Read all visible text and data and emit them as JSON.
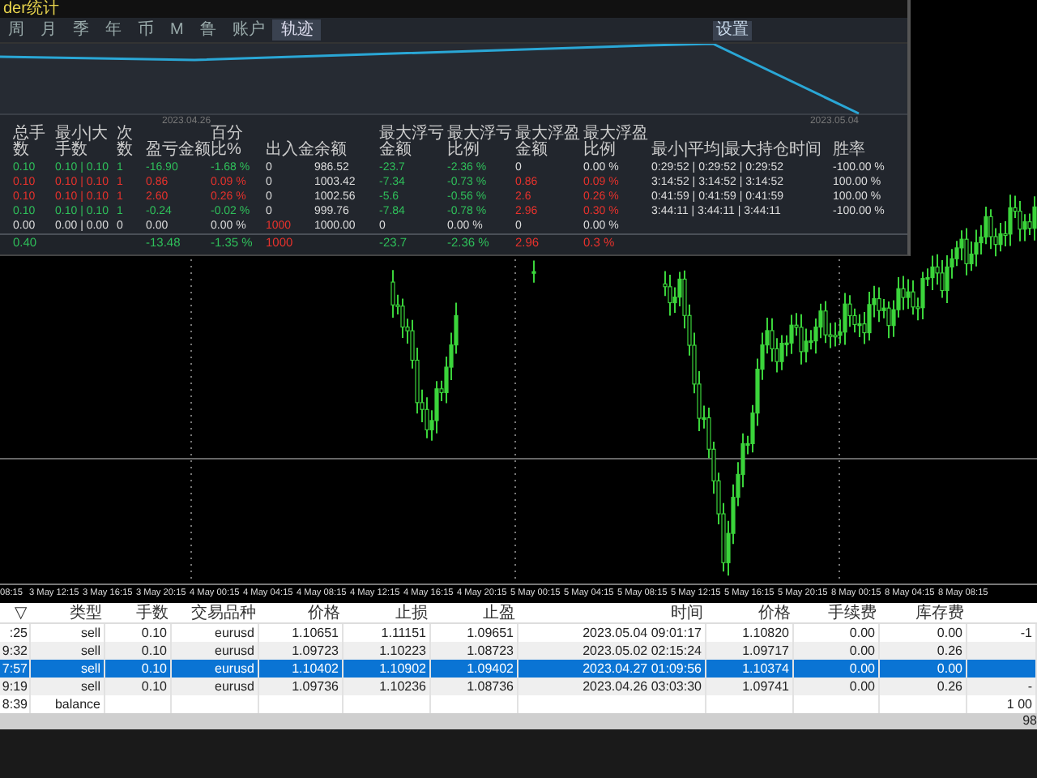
{
  "stats_panel": {
    "title": "der统计",
    "tabs": [
      {
        "label": "周",
        "selected": false
      },
      {
        "label": "月",
        "selected": false
      },
      {
        "label": "季",
        "selected": false
      },
      {
        "label": "年",
        "selected": false
      },
      {
        "label": "币",
        "selected": false
      },
      {
        "label": "M",
        "selected": false
      },
      {
        "label": "鲁",
        "selected": false
      },
      {
        "label": "账户",
        "selected": false
      },
      {
        "label": "轨迹",
        "selected": true
      }
    ],
    "corner_button": "设置",
    "equity_chart": {
      "start_date": "2023.04.26",
      "end_date": "2023.05.04"
    },
    "columns": [
      "总手数",
      "最小|大手数",
      "次数",
      "盈亏金额",
      "百分比%",
      "出入金",
      "余额",
      "最大浮亏金额",
      "最大浮亏比例",
      "最大浮盈金额",
      "最大浮盈比例",
      "最小|平均|最大持仓时间",
      "胜率"
    ],
    "rows": [
      {
        "total": false,
        "cells": [
          {
            "text": "0.10",
            "color": "#2fbf5a"
          },
          {
            "text": "0.10 | 0.10",
            "color": "#2fbf5a"
          },
          {
            "text": "1",
            "color": "#2fbf5a"
          },
          {
            "text": "-16.90",
            "color": "#2fbf5a"
          },
          {
            "text": "-1.68 %",
            "color": "#2fbf5a"
          },
          "0",
          "986.52",
          {
            "text": "-23.7",
            "color": "#2fbf5a"
          },
          {
            "text": "-2.36 %",
            "color": "#2fbf5a"
          },
          "0",
          "0.00 %",
          "0:29:52 | 0:29:52 | 0:29:52",
          "-100.00 %"
        ]
      },
      {
        "total": false,
        "cells": [
          {
            "text": "0.10",
            "color": "#e8322c"
          },
          {
            "text": "0.10 | 0.10",
            "color": "#e8322c"
          },
          {
            "text": "1",
            "color": "#e8322c"
          },
          {
            "text": "0.86",
            "color": "#e8322c"
          },
          {
            "text": "0.09 %",
            "color": "#e8322c"
          },
          "0",
          "1003.42",
          {
            "text": "-7.34",
            "color": "#2fbf5a"
          },
          {
            "text": "-0.73 %",
            "color": "#2fbf5a"
          },
          {
            "text": "0.86",
            "color": "#e8322c"
          },
          {
            "text": "0.09 %",
            "color": "#e8322c"
          },
          "3:14:52 | 3:14:52 | 3:14:52",
          "100.00 %"
        ]
      },
      {
        "total": false,
        "cells": [
          {
            "text": "0.10",
            "color": "#e8322c"
          },
          {
            "text": "0.10 | 0.10",
            "color": "#e8322c"
          },
          {
            "text": "1",
            "color": "#e8322c"
          },
          {
            "text": "2.60",
            "color": "#e8322c"
          },
          {
            "text": "0.26 %",
            "color": "#e8322c"
          },
          "0",
          "1002.56",
          {
            "text": "-5.6",
            "color": "#2fbf5a"
          },
          {
            "text": "-0.56 %",
            "color": "#2fbf5a"
          },
          {
            "text": "2.6",
            "color": "#e8322c"
          },
          {
            "text": "0.26 %",
            "color": "#e8322c"
          },
          "0:41:59 | 0:41:59 | 0:41:59",
          "100.00 %"
        ]
      },
      {
        "total": false,
        "cells": [
          {
            "text": "0.10",
            "color": "#2fbf5a"
          },
          {
            "text": "0.10 | 0.10",
            "color": "#2fbf5a"
          },
          {
            "text": "1",
            "color": "#2fbf5a"
          },
          {
            "text": "-0.24",
            "color": "#2fbf5a"
          },
          {
            "text": "-0.02 %",
            "color": "#2fbf5a"
          },
          "0",
          "999.76",
          {
            "text": "-7.84",
            "color": "#2fbf5a"
          },
          {
            "text": "-0.78 %",
            "color": "#2fbf5a"
          },
          {
            "text": "2.96",
            "color": "#e8322c"
          },
          {
            "text": "0.30 %",
            "color": "#e8322c"
          },
          "3:44:11 | 3:44:11 | 3:44:11",
          "-100.00 %"
        ]
      },
      {
        "total": false,
        "cells": [
          "0.00",
          "0.00 | 0.00",
          "0",
          "0.00",
          "0.00 %",
          {
            "text": "1000",
            "color": "#e8322c"
          },
          "1000.00",
          "0",
          "0.00 %",
          "0",
          "0.00 %"
        ]
      },
      {
        "total": true,
        "cells": [
          {
            "text": "0.40",
            "color": "#2fbf5a"
          },
          null,
          null,
          {
            "text": "-13.48",
            "color": "#2fbf5a"
          },
          {
            "text": "-1.35 %",
            "color": "#2fbf5a"
          },
          {
            "text": "1000",
            "color": "#e8322c"
          },
          null,
          {
            "text": "-23.7",
            "color": "#2fbf5a"
          },
          {
            "text": "-2.36 %",
            "color": "#2fbf5a"
          },
          {
            "text": "2.96",
            "color": "#e8322c"
          },
          {
            "text": "0.3 %",
            "color": "#e8322c"
          }
        ]
      }
    ]
  },
  "price_chart": {
    "time_labels": [
      "08:15",
      "3 May 12:15",
      "3 May 16:15",
      "3 May 20:15",
      "4 May 00:15",
      "4 May 04:15",
      "4 May 08:15",
      "4 May 12:15",
      "4 May 16:15",
      "4 May 20:15",
      "5 May 00:15",
      "5 May 04:15",
      "5 May 08:15",
      "5 May 12:15",
      "5 May 16:15",
      "5 May 20:15",
      "8 May 00:15",
      "8 May 04:15",
      "8 May 08:15"
    ]
  },
  "orders_table": {
    "columns": [
      "▽",
      "类型",
      "手数",
      "交易品种",
      "价格",
      "止损",
      "止盈",
      "时间",
      "价格",
      "手续费",
      "库存费"
    ],
    "rows": [
      {
        "selected": false,
        "cells": [
          ":25",
          "sell",
          "0.10",
          "eurusd",
          "1.10651",
          "1.11151",
          "1.09651",
          "2023.05.04 09:01:17",
          "1.10820",
          "0.00",
          "0.00",
          "-1"
        ]
      },
      {
        "selected": false,
        "cells": [
          "9:32",
          "sell",
          "0.10",
          "eurusd",
          "1.09723",
          "1.10223",
          "1.08723",
          "2023.05.02 02:15:24",
          "1.09717",
          "0.00",
          "0.26"
        ]
      },
      {
        "selected": true,
        "cells": [
          "7:57",
          "sell",
          "0.10",
          "eurusd",
          "1.10402",
          "1.10902",
          "1.09402",
          "2023.04.27 01:09:56",
          "1.10374",
          "0.00",
          "0.00"
        ]
      },
      {
        "selected": false,
        "cells": [
          "9:19",
          "sell",
          "0.10",
          "eurusd",
          "1.09736",
          "1.10236",
          "1.08736",
          "2023.04.26 03:03:30",
          "1.09741",
          "0.00",
          "0.26",
          "-"
        ]
      },
      {
        "selected": false,
        "cells": [
          "8:39",
          "balance",
          null,
          null,
          null,
          null,
          null,
          null,
          null,
          null,
          null,
          "1 00"
        ]
      }
    ],
    "summary": "98"
  }
}
